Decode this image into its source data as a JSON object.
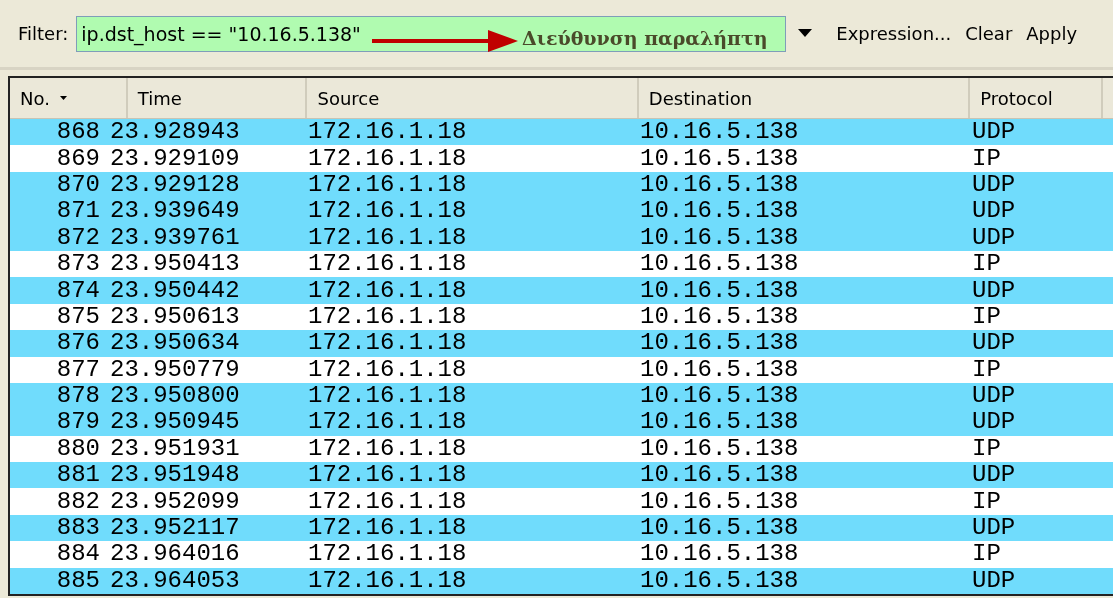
{
  "filter": {
    "label": "Filter:",
    "value": "ip.dst_host == \"10.16.5.138\"",
    "annotation": "Διεύθυνση παραλήπτη",
    "buttons": [
      "Expression...",
      "Clear",
      "Apply"
    ]
  },
  "table": {
    "columns": [
      "No.",
      "Time",
      "Source",
      "Destination",
      "Protocol"
    ],
    "rows": [
      {
        "no": "868",
        "time": "23.928943",
        "source": "172.16.1.18",
        "destination": "10.16.5.138",
        "protocol": "UDP",
        "color": "#70dcfc"
      },
      {
        "no": "869",
        "time": "23.929109",
        "source": "172.16.1.18",
        "destination": "10.16.5.138",
        "protocol": "IP",
        "color": "#ffffff"
      },
      {
        "no": "870",
        "time": "23.929128",
        "source": "172.16.1.18",
        "destination": "10.16.5.138",
        "protocol": "UDP",
        "color": "#70dcfc"
      },
      {
        "no": "871",
        "time": "23.939649",
        "source": "172.16.1.18",
        "destination": "10.16.5.138",
        "protocol": "UDP",
        "color": "#70dcfc"
      },
      {
        "no": "872",
        "time": "23.939761",
        "source": "172.16.1.18",
        "destination": "10.16.5.138",
        "protocol": "UDP",
        "color": "#70dcfc"
      },
      {
        "no": "873",
        "time": "23.950413",
        "source": "172.16.1.18",
        "destination": "10.16.5.138",
        "protocol": "IP",
        "color": "#ffffff"
      },
      {
        "no": "874",
        "time": "23.950442",
        "source": "172.16.1.18",
        "destination": "10.16.5.138",
        "protocol": "UDP",
        "color": "#70dcfc"
      },
      {
        "no": "875",
        "time": "23.950613",
        "source": "172.16.1.18",
        "destination": "10.16.5.138",
        "protocol": "IP",
        "color": "#ffffff"
      },
      {
        "no": "876",
        "time": "23.950634",
        "source": "172.16.1.18",
        "destination": "10.16.5.138",
        "protocol": "UDP",
        "color": "#70dcfc"
      },
      {
        "no": "877",
        "time": "23.950779",
        "source": "172.16.1.18",
        "destination": "10.16.5.138",
        "protocol": "IP",
        "color": "#ffffff"
      },
      {
        "no": "878",
        "time": "23.950800",
        "source": "172.16.1.18",
        "destination": "10.16.5.138",
        "protocol": "UDP",
        "color": "#70dcfc"
      },
      {
        "no": "879",
        "time": "23.950945",
        "source": "172.16.1.18",
        "destination": "10.16.5.138",
        "protocol": "UDP",
        "color": "#70dcfc"
      },
      {
        "no": "880",
        "time": "23.951931",
        "source": "172.16.1.18",
        "destination": "10.16.5.138",
        "protocol": "IP",
        "color": "#ffffff"
      },
      {
        "no": "881",
        "time": "23.951948",
        "source": "172.16.1.18",
        "destination": "10.16.5.138",
        "protocol": "UDP",
        "color": "#70dcfc"
      },
      {
        "no": "882",
        "time": "23.952099",
        "source": "172.16.1.18",
        "destination": "10.16.5.138",
        "protocol": "IP",
        "color": "#ffffff"
      },
      {
        "no": "883",
        "time": "23.952117",
        "source": "172.16.1.18",
        "destination": "10.16.5.138",
        "protocol": "UDP",
        "color": "#70dcfc"
      },
      {
        "no": "884",
        "time": "23.964016",
        "source": "172.16.1.18",
        "destination": "10.16.5.138",
        "protocol": "IP",
        "color": "#ffffff"
      },
      {
        "no": "885",
        "time": "23.964053",
        "source": "172.16.1.18",
        "destination": "10.16.5.138",
        "protocol": "UDP",
        "color": "#70dcfc"
      }
    ]
  }
}
